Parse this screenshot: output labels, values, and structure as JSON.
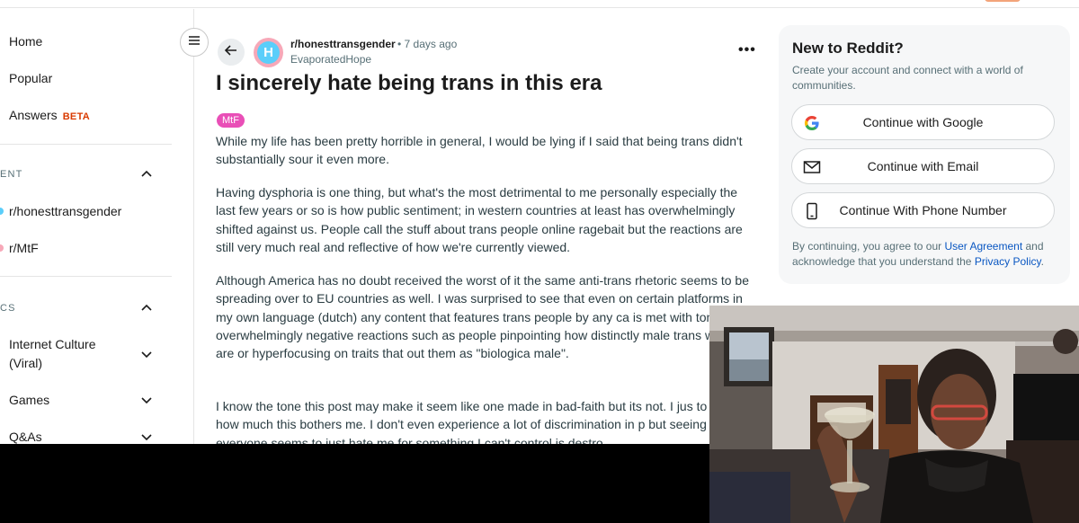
{
  "sidebar": {
    "nav": [
      {
        "label": "Home"
      },
      {
        "label": "Popular"
      },
      {
        "label": "Answers",
        "badge": "BETA"
      }
    ],
    "recent_header": "ENT",
    "recent_items": [
      {
        "label": "r/honesttransgender"
      },
      {
        "label": "r/MtF"
      }
    ],
    "topics_header": "CS",
    "topics": [
      {
        "label": "Internet Culture (Viral)"
      },
      {
        "label": "Games"
      },
      {
        "label": "Q&As"
      }
    ]
  },
  "post": {
    "subreddit": "r/honesttransgender",
    "age": "• 7 days ago",
    "author": "EvaporatedHope",
    "more_label": "•••",
    "title": "I sincerely hate being trans in this era",
    "flair": "MtF",
    "paragraphs": [
      "While my life has been pretty horrible in general, I would be lying if I said that being trans didn't substantially sour it even more.",
      "Having dysphoria is one thing, but what's the most detrimental to me personally especially the last few years or so is how public sentiment; in western countries at least has overwhelmingly shifted against us. People call the stuff about trans people online ragebait but the reactions are still very much real and reflective of how we're currently viewed.",
      "Although America has no doubt received the worst of it the same anti-trans rhetoric seems to be spreading over to EU countries as well. I was surprised to see that even on certain platforms in my own language (dutch) any content that features trans people by any ca is met with tons of overwhelmingly negative reactions such as people pinpointing how distinctly male trans women are or hyperfocusing on traits that out them as \"biologica male\".",
      "I know the tone this post may make it seem like one made in bad-faith but its not. I jus to share how much this bothers me. I don't even experience a lot of discrimination in p but seeing how everyone seems to just hate me for something I can't control is destro"
    ]
  },
  "signup": {
    "title": "New to Reddit?",
    "description": "Create your account and connect with a world of communities.",
    "google_label": "Continue with Google",
    "email_label": "Continue with Email",
    "phone_label": "Continue With Phone Number",
    "legal_prefix": "By continuing, you agree to our ",
    "legal_agreement": "User Agreement",
    "legal_middle": " and acknowledge that you understand the ",
    "legal_privacy": "Privacy Policy",
    "legal_suffix": "."
  },
  "colors": {
    "accent_link": "#0a57c2",
    "flair_bg": "#e94fb7",
    "beta": "#d93a00"
  }
}
